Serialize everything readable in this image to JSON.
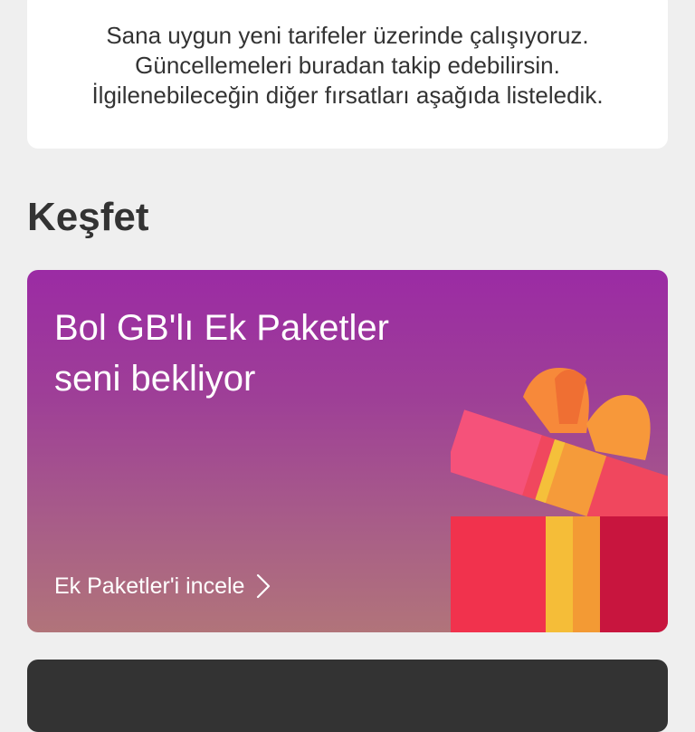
{
  "info": {
    "lines": [
      "Sana uygun yeni tarifeler üzerinde çalışıyoruz.",
      "Güncellemeleri buradan takip edebilirsin.",
      "İlgilenebileceğin diğer fırsatları aşağıda listeledik."
    ]
  },
  "section": {
    "title": "Keşfet"
  },
  "promo": {
    "title_line1": "Bol GB'lı Ek Paketler",
    "title_line2": "seni bekliyor",
    "link_label": "Ek Paketler'i incele",
    "icon": "gift-box-icon",
    "colors": {
      "gradient_top": "#9b2ba4",
      "gradient_bottom": "#b1747a"
    }
  },
  "colors": {
    "background": "#efefef",
    "card": "#ffffff",
    "text": "#333333",
    "dark_card": "#333333"
  }
}
